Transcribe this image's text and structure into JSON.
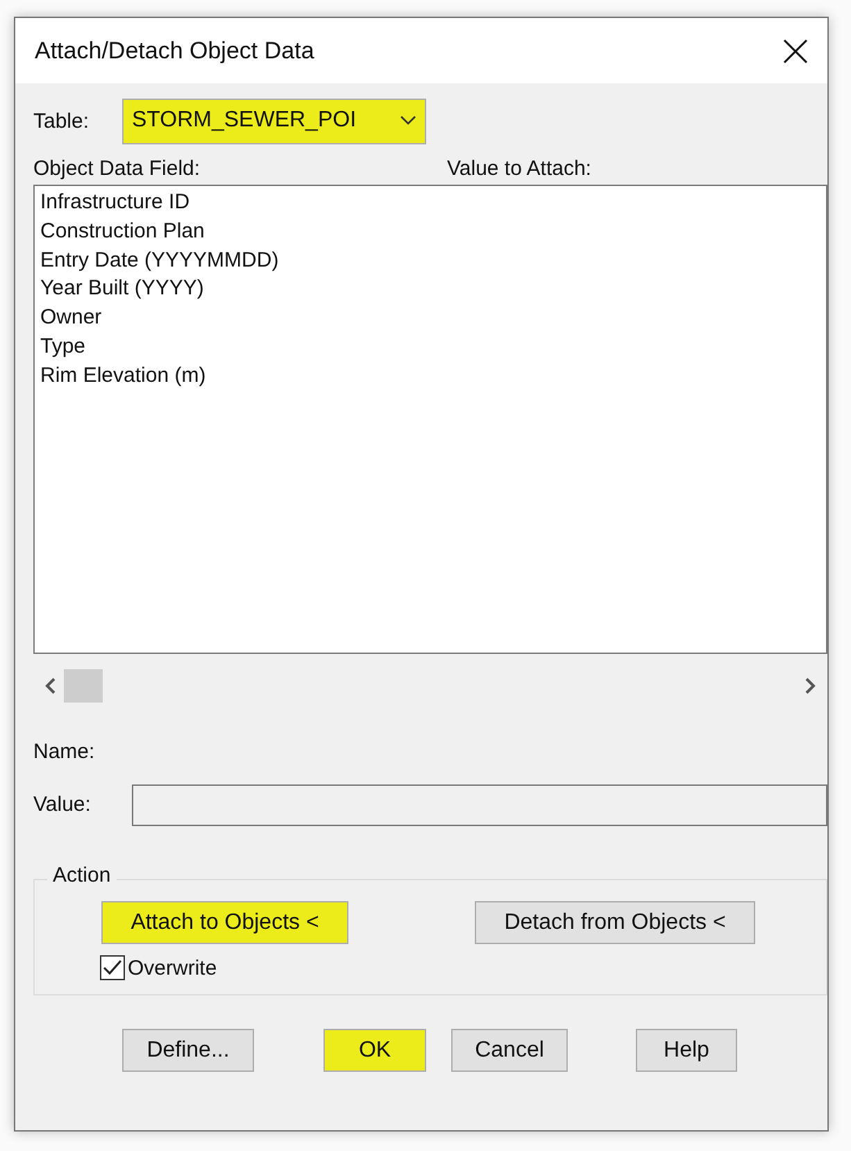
{
  "window": {
    "title": "Attach/Detach Object Data"
  },
  "table": {
    "label": "Table:",
    "value": "STORM_SEWER_POI",
    "highlighted": true
  },
  "columns": [
    "Object Data Field:",
    "Value to Attach:"
  ],
  "fields": [
    "Infrastructure ID",
    "Construction Plan",
    "Entry Date (YYYYMMDD)",
    "Year Built (YYYY)",
    "Owner",
    "Type",
    "Rim Elevation (m)"
  ],
  "name_label": "Name:",
  "value_field": {
    "label": "Value:"
  },
  "action": {
    "title": "Action",
    "buttons": [
      {
        "label": "Attach to Objects <",
        "highlighted": true
      },
      {
        "label": "Detach from Objects <",
        "highlighted": false
      }
    ],
    "overwrite": {
      "label": "Overwrite",
      "checked": true
    }
  },
  "buttons": [
    {
      "label": "Define...",
      "highlighted": false
    },
    {
      "label": "OK",
      "highlighted": true
    },
    {
      "label": "Cancel",
      "highlighted": false
    },
    {
      "label": "Help",
      "highlighted": false
    }
  ]
}
